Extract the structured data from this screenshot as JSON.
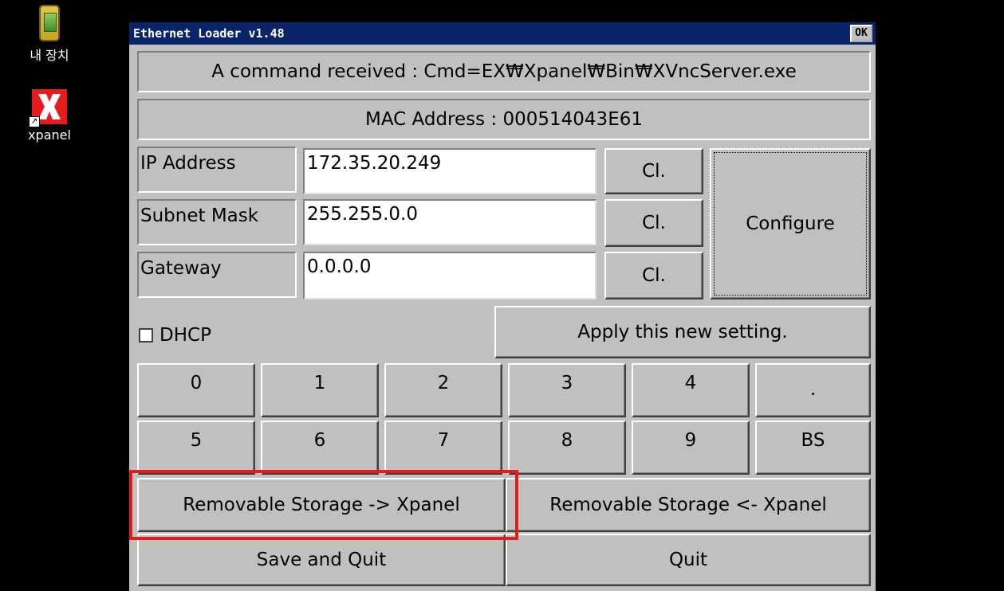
{
  "desktop": {
    "icons": [
      {
        "label": "내 장치",
        "icon": "device-icon"
      },
      {
        "label": "xpanel",
        "icon": "xpanel-icon"
      }
    ]
  },
  "window": {
    "title": "Ethernet Loader v1.48",
    "ok_label": "OK",
    "command_text": "A command received : Cmd=EX₩Xpanel₩Bin₩XVncServer.exe",
    "mac_text": "MAC Address : 000514043E61",
    "fields": {
      "ip": {
        "label": "IP Address",
        "value": "172.35.20.249",
        "clear_label": "Cl."
      },
      "subnet": {
        "label": "Subnet Mask",
        "value": "255.255.0.0",
        "clear_label": "Cl."
      },
      "gateway": {
        "label": "Gateway",
        "value": "0.0.0.0",
        "clear_label": "Cl."
      }
    },
    "configure_label": "Configure",
    "dhcp_label": "DHCP",
    "dhcp_checked": false,
    "apply_label": "Apply this new setting.",
    "keypad": {
      "row1": [
        "0",
        "1",
        "2",
        "3",
        "4",
        "."
      ],
      "row2": [
        "5",
        "6",
        "7",
        "8",
        "9",
        "BS"
      ]
    },
    "storage_to_xpanel_label": "Removable Storage -> Xpanel",
    "storage_from_xpanel_label": "Removable Storage <- Xpanel",
    "save_quit_label": "Save and Quit",
    "quit_label": "Quit"
  },
  "colors": {
    "titlebar": "#0a246a",
    "highlight": "#e21b1b",
    "face": "#c0c0c0"
  }
}
